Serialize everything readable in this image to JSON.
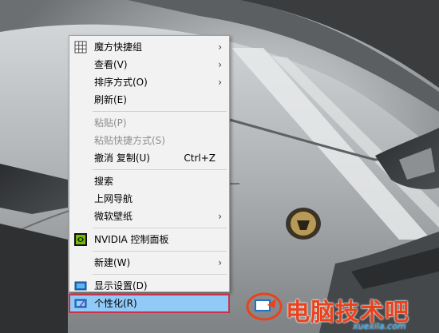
{
  "menu": {
    "items": [
      {
        "label": "魔方快捷组",
        "submenu": true,
        "icon": "grid-icon"
      },
      {
        "label": "查看(V)",
        "submenu": true
      },
      {
        "label": "排序方式(O)",
        "submenu": true
      },
      {
        "label": "刷新(E)"
      },
      {
        "label": "粘贴(P)",
        "disabled": true
      },
      {
        "label": "粘贴快捷方式(S)",
        "disabled": true
      },
      {
        "label": "撤消 复制(U)",
        "shortcut": "Ctrl+Z"
      },
      {
        "label": "搜索"
      },
      {
        "label": "上网导航"
      },
      {
        "label": "微软壁纸",
        "submenu": true
      },
      {
        "label": "NVIDIA 控制面板",
        "icon": "nvidia-icon"
      },
      {
        "label": "新建(W)",
        "submenu": true
      },
      {
        "label": "显示设置(D)",
        "icon": "display-icon"
      },
      {
        "label": "个性化(R)",
        "icon": "personalize-icon",
        "highlighted": true
      }
    ],
    "arrow_glyph": "›",
    "highlight_color": "#91c9f7",
    "highlight_border_color": "#c7344a"
  },
  "watermark": {
    "title": "电脑技术吧",
    "url": "xuexila.com",
    "color": "#e8431d"
  }
}
